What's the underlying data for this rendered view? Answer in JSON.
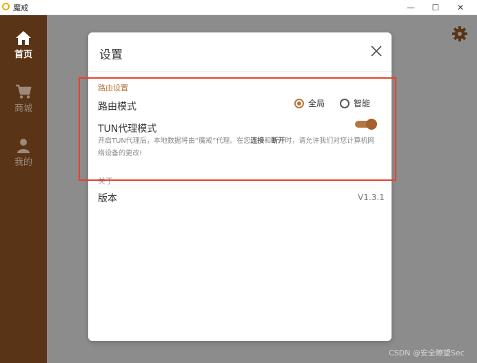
{
  "window": {
    "title": "魔戒",
    "controls": {
      "minimize": "—",
      "maximize": "☐",
      "close": "✕"
    }
  },
  "sidebar": {
    "items": [
      {
        "label": "首页",
        "icon": "home-icon",
        "active": true
      },
      {
        "label": "商城",
        "icon": "cart-icon",
        "active": false
      },
      {
        "label": "我的",
        "icon": "user-icon",
        "active": false
      }
    ]
  },
  "main": {
    "settings_icon": "gear-icon"
  },
  "dialog": {
    "title": "设置",
    "close_icon": "close-icon",
    "route_section": {
      "label": "路由设置",
      "route_mode_label": "路由模式",
      "options": [
        {
          "label": "全局",
          "checked": true
        },
        {
          "label": "智能",
          "checked": false
        }
      ],
      "tun_label": "TUN代理模式",
      "tun_enabled": true,
      "description": {
        "part1": "开启TUN代理后，本地数据将由“魔戒”代理。在您",
        "bold1": "连接",
        "part2": "和",
        "bold2": "断开",
        "part3": "时，请允许我们对您计算机网络设备的更改!"
      }
    },
    "about_section": {
      "label": "关于",
      "version_label": "版本",
      "version_value": "V1.3.1"
    }
  },
  "colors": {
    "sidebar": "#5a3416",
    "accent": "#b5773f",
    "highlight": "#e8402a"
  },
  "watermark": "CSDN @安全瞭望Sec"
}
